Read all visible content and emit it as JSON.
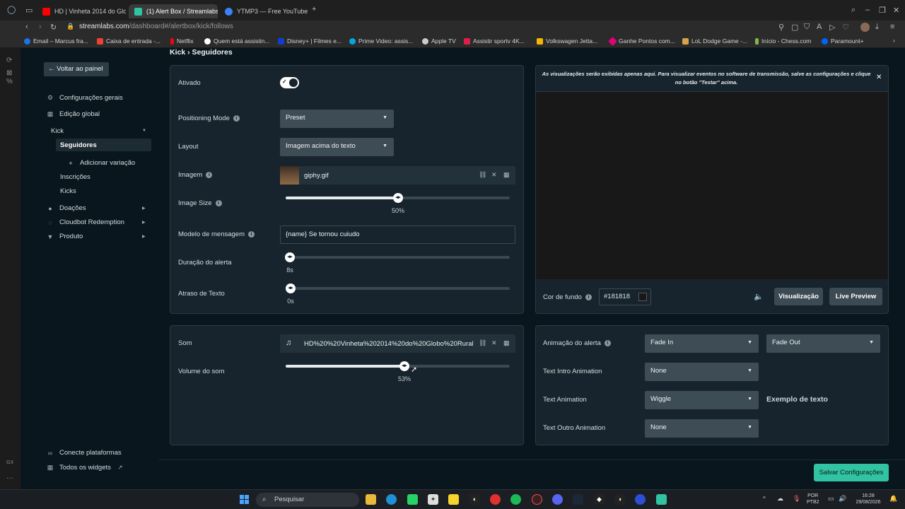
{
  "browser": {
    "tabs": [
      {
        "title": "HD | Vinheta 2014 do Globo",
        "favicon_color": "#ff0000"
      },
      {
        "title": "(1) Alert Box / Streamlabs",
        "favicon_color": "#31c3a2"
      },
      {
        "title": "YTMP3 — Free YouTube to",
        "favicon_color": "#3b82f6"
      }
    ],
    "new_tab": "+",
    "url_host": "streamlabs.com",
    "url_path": "/dashboard#/alertbox/kick/follows",
    "bookmarks": [
      {
        "label": "Email – Marcus fra...",
        "color": "#1a73e8"
      },
      {
        "label": "Caixa de entrada -...",
        "color": "#ea4335"
      },
      {
        "label": "Netflix",
        "color": "#e50914"
      },
      {
        "label": "Quem está assistin...",
        "color": "#ffffff"
      },
      {
        "label": "Disney+ | Filmes e...",
        "color": "#113ccf"
      },
      {
        "label": "Prime Video: assis...",
        "color": "#00a8e1"
      },
      {
        "label": "Apple TV",
        "color": "#cccccc"
      },
      {
        "label": "Assistir sportv 4K...",
        "color": "#e11d48"
      },
      {
        "label": "Volkswagen Jetta...",
        "color": "#f5b700"
      },
      {
        "label": "Ganhe Pontos com...",
        "color": "#e4007c"
      },
      {
        "label": "LoL Dodge Game -...",
        "color": "#d4a54a"
      },
      {
        "label": "Início - Chess.com",
        "color": "#81b64c"
      },
      {
        "label": "Paramount+",
        "color": "#0064ff"
      }
    ]
  },
  "page": {
    "breadcrumb": "Kick › Seguidores"
  },
  "sidebar": {
    "back_button": "Voltar ao painel",
    "items": [
      {
        "label": "Configurações gerais",
        "icon": "gear-icon"
      },
      {
        "label": "Edição global",
        "icon": "grid-icon"
      },
      {
        "label": "Kick"
      },
      {
        "label": "Seguidores"
      },
      {
        "label": "Adicionar variação",
        "icon": "plus-icon"
      },
      {
        "label": "Inscrições"
      },
      {
        "label": "Kicks"
      },
      {
        "label": "Doações",
        "icon": "coins-icon"
      },
      {
        "label": "Cloudbot Redemption",
        "icon": "refresh-icon"
      },
      {
        "label": "Produto",
        "icon": "shirt-icon"
      }
    ],
    "bottom": [
      {
        "label": "Conecte plataformas",
        "icon": "link-icon"
      },
      {
        "label": "Todos os widgets",
        "icon": "widgets-icon"
      }
    ]
  },
  "settings": {
    "enabled_label": "Ativado",
    "enabled": true,
    "positioning_label": "Positioning Mode",
    "positioning_value": "Preset",
    "layout_label": "Layout",
    "layout_value": "Imagem acima do texto",
    "image_label": "Imagem",
    "image_file": "giphy.gif",
    "image_size_label": "Image Size",
    "image_size_value": "50%",
    "image_size_fraction": 0.5,
    "message_label": "Modelo de mensagem",
    "message_value": "{name} Se tornou cuiudo",
    "duration_label": "Duração do alerta",
    "duration_value": "8s",
    "duration_fraction": 0.02,
    "text_delay_label": "Atraso de Texto",
    "text_delay_value": "0s",
    "text_delay_fraction": 0.0
  },
  "sound": {
    "label": "Som",
    "file": "HD%20%20Vinheta%202014%20do%20Globo%20Rural...",
    "volume_label": "Volume do som",
    "volume_value": "53%",
    "volume_fraction": 0.53
  },
  "preview": {
    "notice": "As visualizações serão exibidas apenas aqui. Para visualizar eventos no software de transmissão, salve as configurações e clique no botão \"Testar\" acima.",
    "bg_color_label": "Cor de fundo",
    "bg_color_value": "#181818",
    "visualize_button": "Visualização",
    "live_preview_button": "Live Preview"
  },
  "animation": {
    "alert_label": "Animação do alerta",
    "alert_in": "Fade In",
    "alert_out": "Fade Out",
    "intro_label": "Text Intro Animation",
    "intro_value": "None",
    "text_label": "Text Animation",
    "text_value": "Wiggle",
    "example_text": "Exemplo de texto",
    "outro_label": "Text Outro Animation",
    "outro_value": "None"
  },
  "save_button": "Salvar Configurações",
  "taskbar": {
    "search_placeholder": "Pesquisar",
    "lang_top": "POR",
    "lang_bottom": "PTB2",
    "time": "16:28",
    "date": "29/08/2026"
  },
  "colors": {
    "accent": "#31c3a2",
    "bg": "#09161d",
    "panel": "#17242d"
  }
}
